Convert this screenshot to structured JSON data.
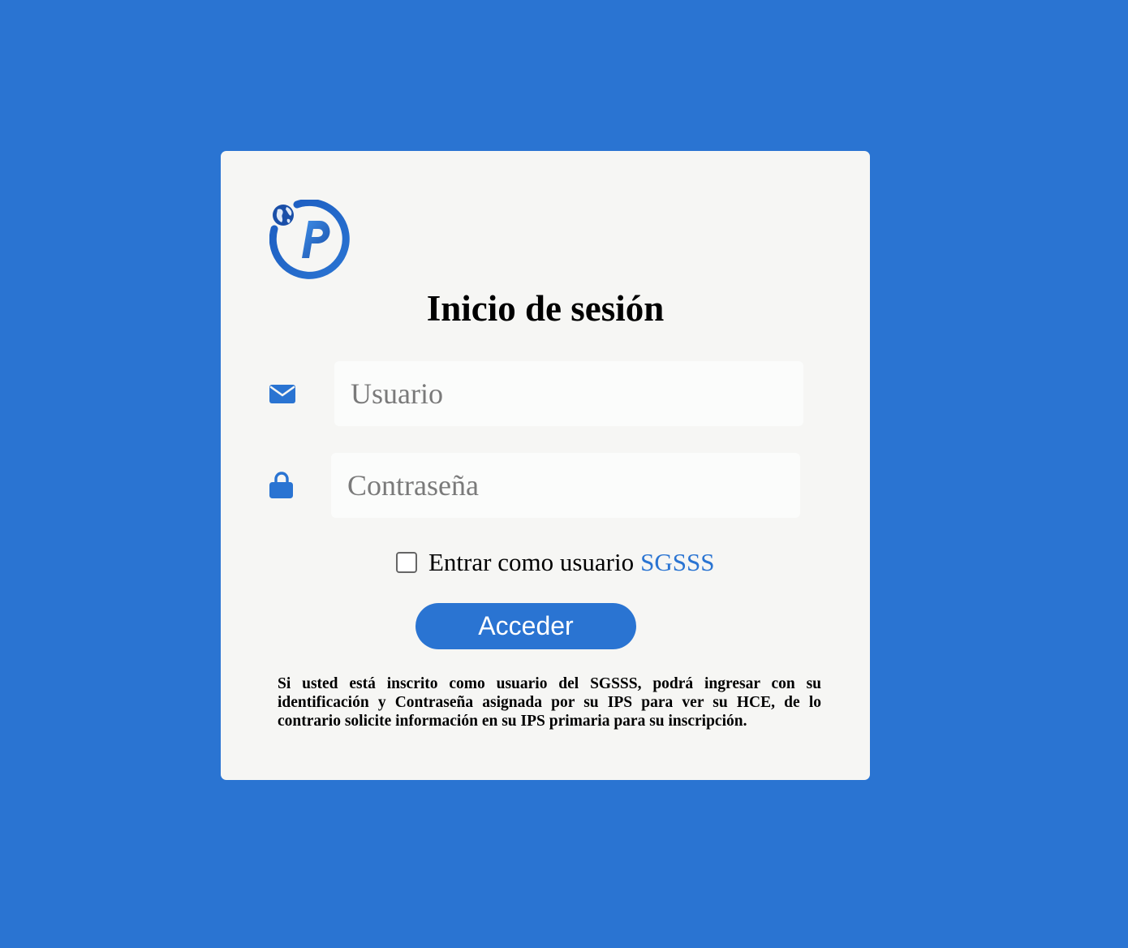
{
  "page": {
    "background_color": "#2a74d2",
    "card_color": "#f6f6f4"
  },
  "logo": {
    "icon": "globe-p-logo",
    "letter": "P"
  },
  "title": "Inicio de sesión",
  "username": {
    "icon": "envelope-icon",
    "placeholder": "Usuario",
    "value": ""
  },
  "password": {
    "icon": "lock-icon",
    "placeholder": "Contraseña",
    "value": ""
  },
  "sgsss_option": {
    "label": "Entrar como usuario",
    "link_text": "SGSSS",
    "checked": false
  },
  "submit_label": "Acceder",
  "notice": "Si usted está inscrito como usuario del SGSSS, podrá ingresar con su identificación y Contraseña asignada por su IPS para ver su HCE, de lo contrario solicite información en su IPS primaria para su inscripción.",
  "colors": {
    "accent": "#2a74d2",
    "logo_dark": "#1a4fa8",
    "text": "#000000",
    "placeholder": "#7a7a7a"
  }
}
